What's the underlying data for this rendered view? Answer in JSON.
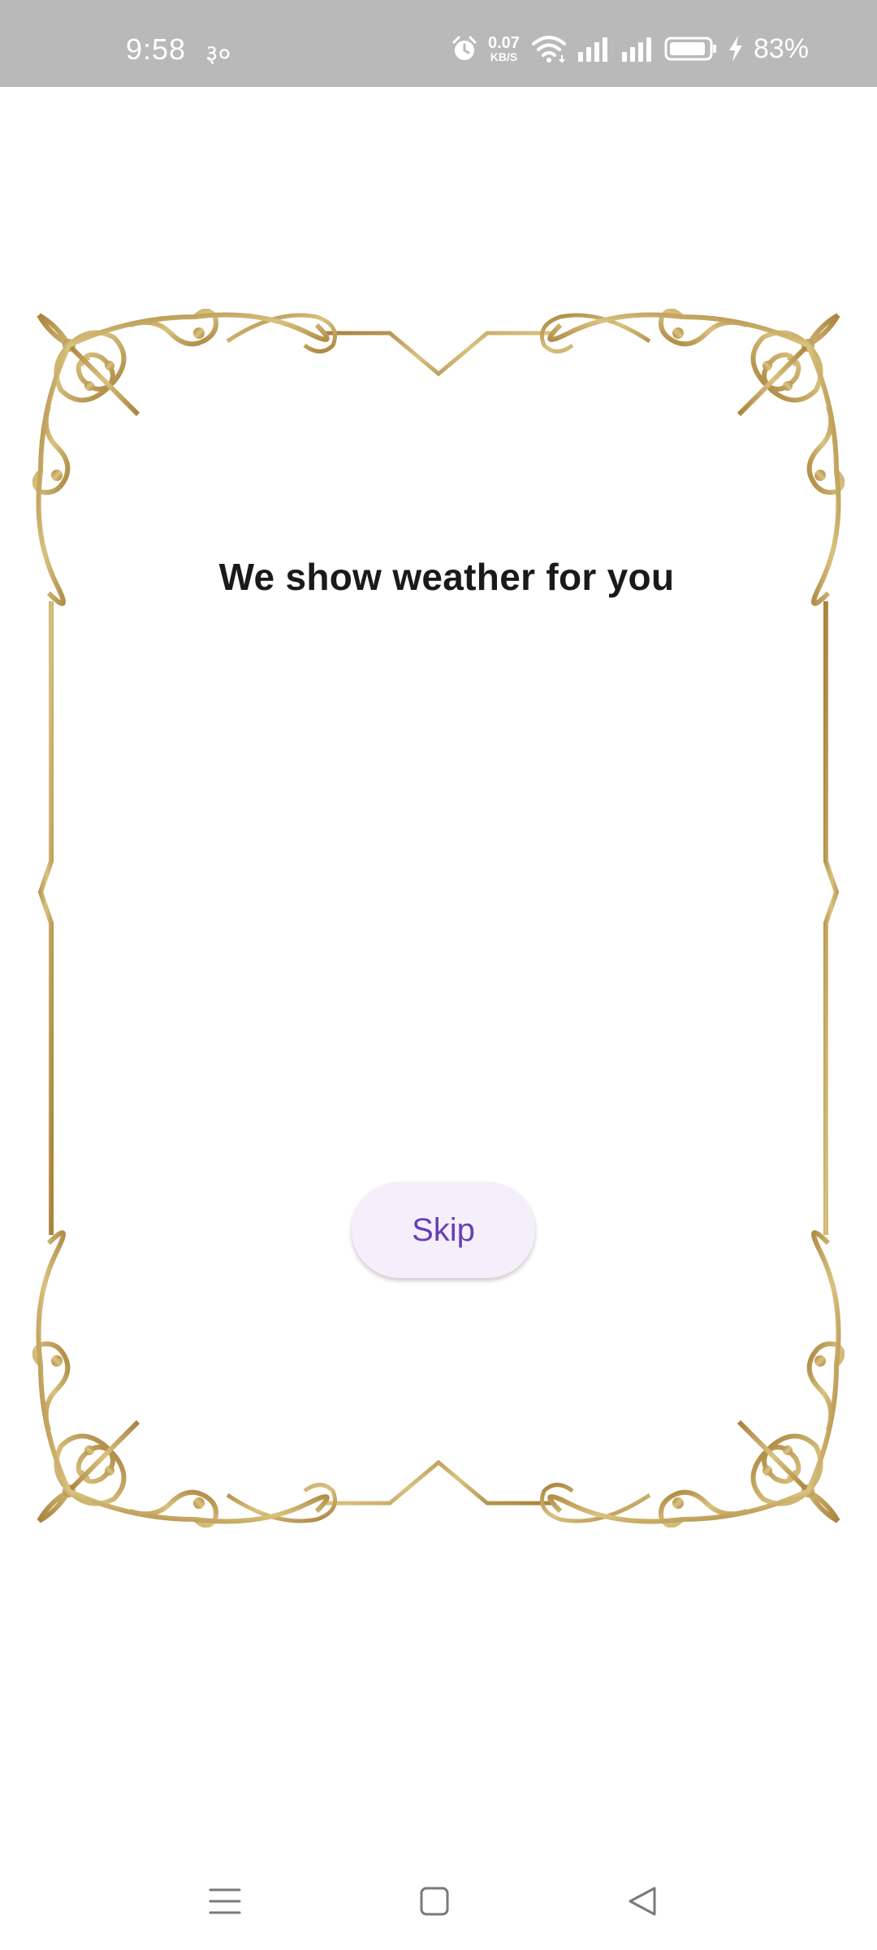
{
  "status_bar": {
    "time": "9:58",
    "extra_indicator": "३०",
    "net_speed_value": "0.07",
    "net_speed_unit": "KB/S",
    "battery_percent": "83%",
    "icons": [
      "alarm-icon",
      "wifi-icon",
      "signal-icon",
      "signal-icon",
      "battery-icon",
      "charging-icon"
    ]
  },
  "main": {
    "headline": "We show weather for you",
    "skip_label": "Skip"
  },
  "nav_bar": {
    "buttons": [
      "menu-icon",
      "home-icon",
      "back-icon"
    ]
  },
  "colors": {
    "frame_gold": "#b8964f",
    "accent_purple": "#6a3fb3",
    "button_bg": "#f4effa",
    "status_bar_bg": "#b9b9b9"
  }
}
